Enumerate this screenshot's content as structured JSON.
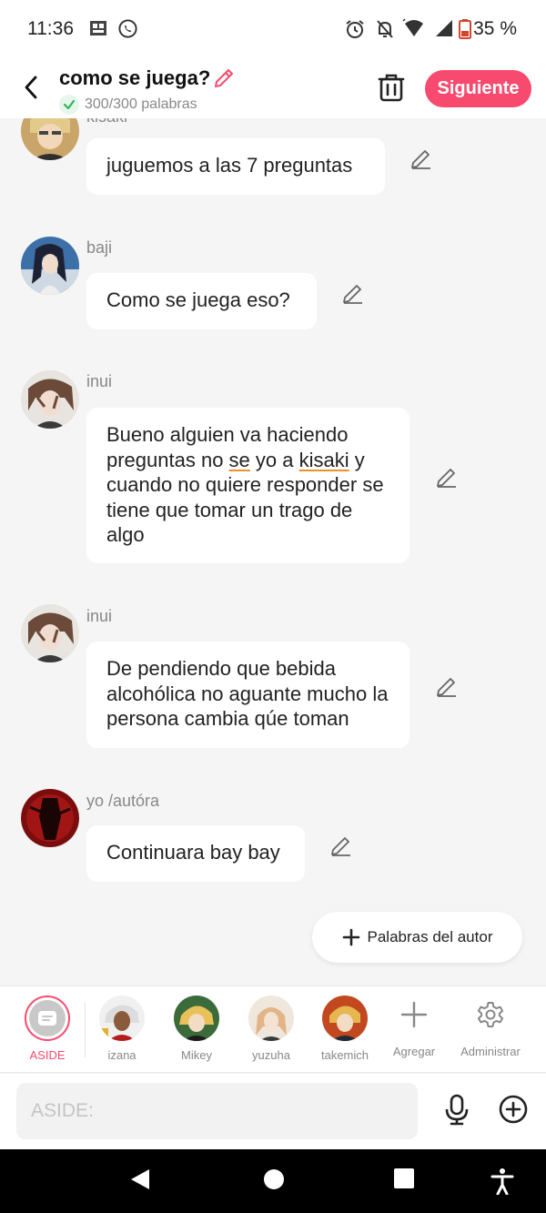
{
  "status": {
    "time": "11:36",
    "battery": "35 %"
  },
  "header": {
    "title": "como se juega?",
    "word_count": "300/300 palabras",
    "next_label": "Siguiente"
  },
  "messages": [
    {
      "name": "kisaki",
      "text": "juguemos a las 7 preguntas"
    },
    {
      "name": "baji",
      "text": "Como se juega eso?"
    },
    {
      "name": "inui",
      "text_parts": [
        "Bueno alguien va haciendo preguntas no ",
        "se",
        " yo a ",
        "kisaki",
        " y cuando no quiere responder se tiene que tomar un trago de algo"
      ]
    },
    {
      "name": "inui",
      "text": "De pendiendo que bebida alcohólica no aguante mucho la persona cambia qúe toman"
    },
    {
      "name": "yo /autóra",
      "text": "Continuara bay bay"
    }
  ],
  "fab_label": "Palabras del autor",
  "characters": [
    {
      "label": "ASIDE",
      "color": "#f74a6e"
    },
    {
      "label": "izana"
    },
    {
      "label": "Mikey"
    },
    {
      "label": "yuzuha"
    },
    {
      "label": "takemich"
    },
    {
      "label": "Agregar"
    },
    {
      "label": "Administrar"
    }
  ],
  "input": {
    "placeholder": "ASIDE:"
  },
  "colors": {
    "accent": "#f74a6e",
    "background": "#f5f5f5",
    "bubble": "#ffffff"
  }
}
